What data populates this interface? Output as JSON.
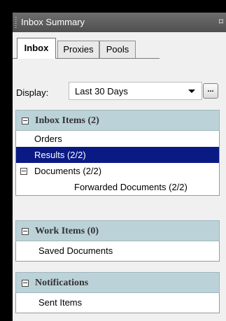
{
  "window": {
    "title": "Inbox Summary",
    "pin_glyph": "⌑"
  },
  "tabs": [
    {
      "label": "Inbox",
      "active": true
    },
    {
      "label": "Proxies",
      "active": false
    },
    {
      "label": "Pools",
      "active": false
    }
  ],
  "display": {
    "label": "Display:",
    "value": "Last 30 Days",
    "more_label": "..."
  },
  "sections": [
    {
      "title": "Inbox Items (2)",
      "items": [
        {
          "label": "Orders",
          "level": 1,
          "selected": false
        },
        {
          "label": "Results (2/2)",
          "level": 1,
          "selected": true
        },
        {
          "label": "Documents (2/2)",
          "level": 1,
          "selected": false,
          "expandable": true
        },
        {
          "label": "Forwarded Documents (2/2)",
          "level": 2,
          "selected": false
        }
      ]
    },
    {
      "title": "Work Items (0)",
      "items": [
        {
          "label": "Saved Documents",
          "level": 1,
          "selected": false
        }
      ]
    },
    {
      "title": "Notifications",
      "items": [
        {
          "label": "Sent Items",
          "level": 1,
          "selected": false
        }
      ]
    }
  ],
  "colors": {
    "selection": "#0a1a84",
    "section_header": "#bcd2d9",
    "titlebar": "#5f5f5f"
  }
}
